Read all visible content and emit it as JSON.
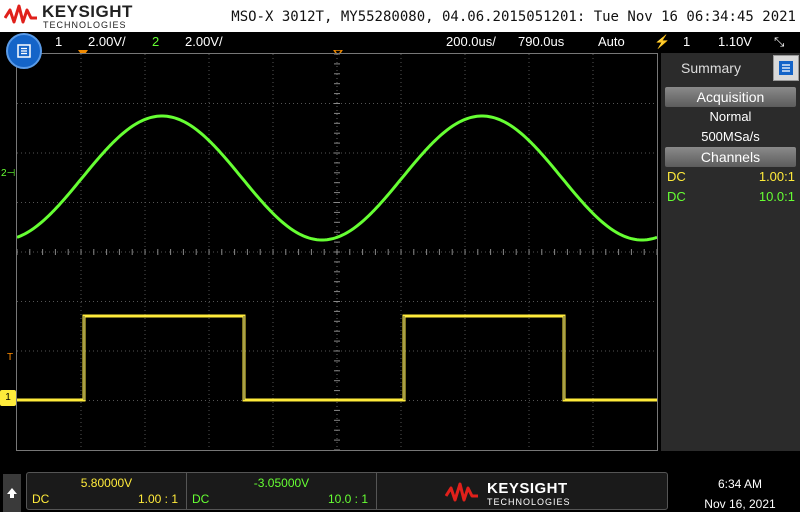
{
  "header": {
    "brand": "KEYSIGHT",
    "brand_sub": "TECHNOLOGIES",
    "device_info": "MSO-X 3012T, MY55280080, 04.06.2015051201: Tue Nov 16 06:34:45 2021"
  },
  "status_bar": {
    "ch1_label": "1",
    "ch1_scale": "2.00V/",
    "ch2_label": "2",
    "ch2_scale": "2.00V/",
    "timebase": "200.0us/",
    "delay": "790.0us",
    "trigger_mode": "Auto",
    "trigger_source": "1",
    "trigger_level": "1.10V"
  },
  "markers": {
    "ch2": "2",
    "trigger": "T",
    "ch1": "1"
  },
  "panel": {
    "tab_label": "Summary",
    "acquisition_header": "Acquisition",
    "acquisition_mode": "Normal",
    "sample_rate": "500MSa/s",
    "channels_header": "Channels",
    "channels": [
      {
        "coupling": "DC",
        "probe": "1.00:1",
        "color": "#ffeb3b"
      },
      {
        "coupling": "DC",
        "probe": "10.0:1",
        "color": "#66ff33"
      }
    ]
  },
  "bottom": {
    "ch1": {
      "offset": "5.80000V",
      "coupling": "DC",
      "probe": "1.00 : 1"
    },
    "ch2": {
      "offset": "-3.05000V",
      "coupling": "DC",
      "probe": "10.0 : 1"
    },
    "brand": "KEYSIGHT",
    "brand_sub": "TECHNOLOGIES",
    "time": "6:34 AM",
    "date": "Nov 16, 2021"
  },
  "colors": {
    "ch1": "#ffeb3b",
    "ch2": "#66ff33",
    "brand_red": "#e0201b",
    "menu_blue": "#1464c8"
  }
}
